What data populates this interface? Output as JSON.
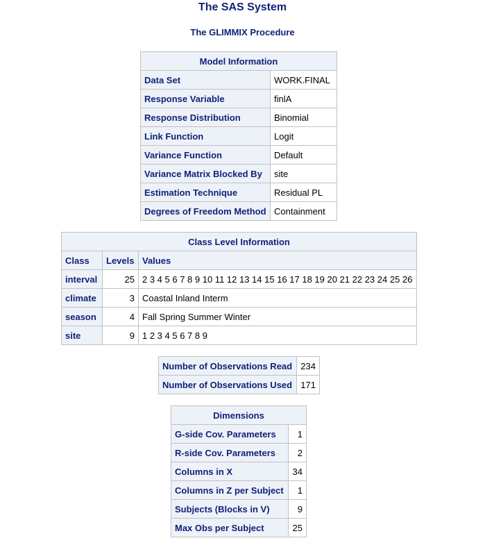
{
  "header": {
    "system_title": "The SAS System",
    "procedure_title": "The GLIMMIX Procedure"
  },
  "model_info": {
    "caption": "Model Information",
    "rows": [
      {
        "label": "Data Set",
        "value": "WORK.FINAL"
      },
      {
        "label": "Response Variable",
        "value": "finlA"
      },
      {
        "label": "Response Distribution",
        "value": "Binomial"
      },
      {
        "label": "Link Function",
        "value": "Logit"
      },
      {
        "label": "Variance Function",
        "value": "Default"
      },
      {
        "label": "Variance Matrix Blocked By",
        "value": "site"
      },
      {
        "label": "Estimation Technique",
        "value": "Residual PL"
      },
      {
        "label": "Degrees of Freedom Method",
        "value": "Containment"
      }
    ]
  },
  "class_levels": {
    "caption": "Class Level Information",
    "columns": [
      "Class",
      "Levels",
      "Values"
    ],
    "rows": [
      {
        "class": "interval",
        "levels": "25",
        "values": "2 3 4 5 6 7 8 9 10 11 12 13 14 15 16 17 18 19 20 21 22 23 24 25 26"
      },
      {
        "class": "climate",
        "levels": "3",
        "values": "Coastal Inland Interm"
      },
      {
        "class": "season",
        "levels": "4",
        "values": "Fall Spring Summer Winter"
      },
      {
        "class": "site",
        "levels": "9",
        "values": "1 2 3 4 5 6 7 8 9"
      }
    ]
  },
  "observations": {
    "rows": [
      {
        "label": "Number of Observations Read",
        "value": "234"
      },
      {
        "label": "Number of Observations Used",
        "value": "171"
      }
    ]
  },
  "dimensions": {
    "caption": "Dimensions",
    "rows": [
      {
        "label": "G-side Cov. Parameters",
        "value": "1"
      },
      {
        "label": "R-side Cov. Parameters",
        "value": "2"
      },
      {
        "label": "Columns in X",
        "value": "34"
      },
      {
        "label": "Columns in Z per Subject",
        "value": "1"
      },
      {
        "label": "Subjects (Blocks in V)",
        "value": "9"
      },
      {
        "label": "Max Obs per Subject",
        "value": "25"
      }
    ]
  }
}
